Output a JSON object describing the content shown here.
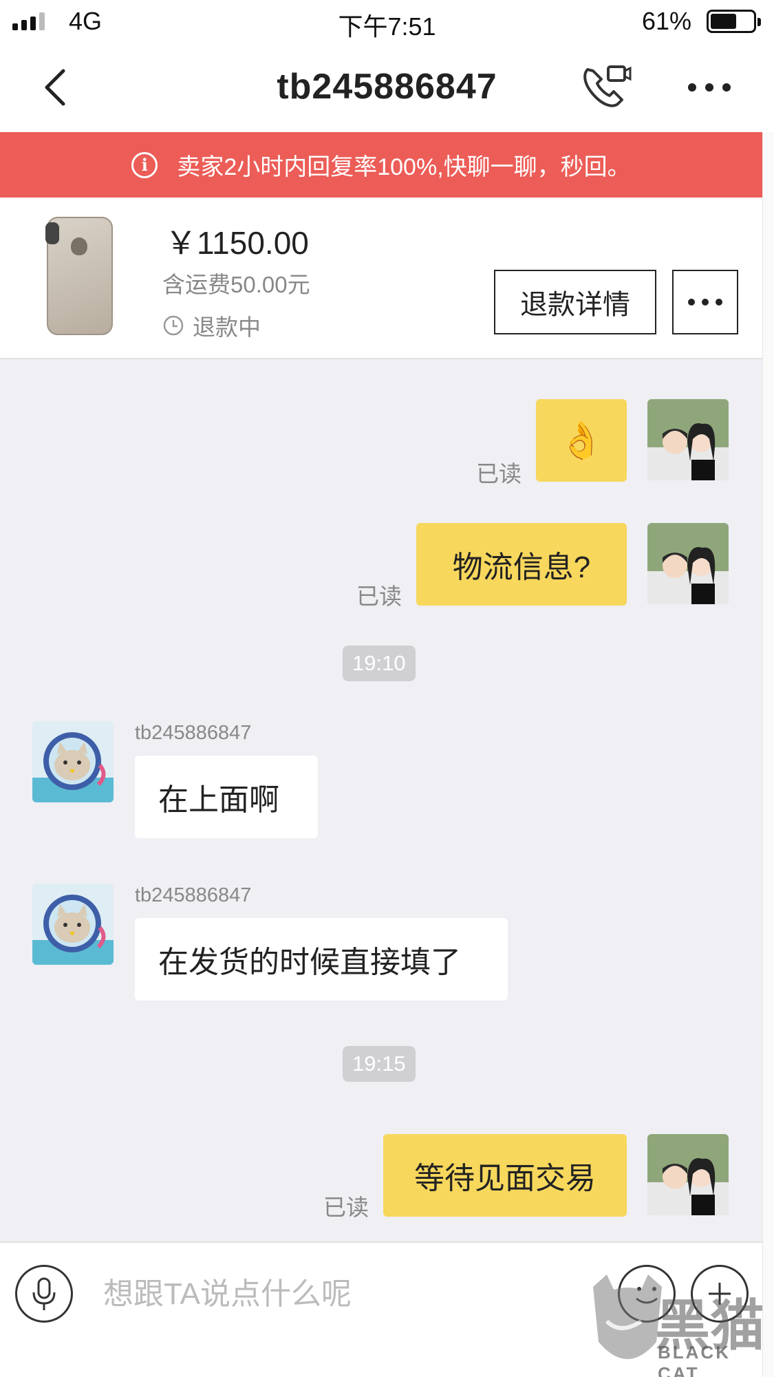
{
  "status_bar": {
    "carrier": "4G",
    "time": "下午7:51",
    "battery": "61%",
    "battery_level": 0.61
  },
  "nav": {
    "title": "tb245886847",
    "icons": [
      "back-icon",
      "phone-video-icon",
      "more-icon"
    ]
  },
  "banner": {
    "text": "卖家2小时内回复率100%,快聊一聊，秒回。",
    "icon": "info-icon",
    "color": "#ec5d57"
  },
  "order": {
    "price": "￥1150.00",
    "shipping": "含运费50.00元",
    "status": "退款中",
    "refund_button": "退款详情",
    "more_button": "more-icon"
  },
  "messages": {
    "m1": {
      "read": "已读",
      "content": "👌"
    },
    "m2": {
      "read": "已读",
      "content": "物流信息?"
    },
    "t1": "19:10",
    "m3": {
      "sender": "tb245886847",
      "content": "在上面啊"
    },
    "m4": {
      "sender": "tb245886847",
      "content": "在发货的时候直接填了"
    },
    "t2": "19:15",
    "m5": {
      "read": "已读",
      "content": "等待见面交易"
    }
  },
  "input": {
    "placeholder": "想跟TA说点什么呢"
  },
  "watermark": {
    "text": "黑猫",
    "sub": "BLACK CAT"
  },
  "colors": {
    "my_bubble": "#f7d75c",
    "their_bubble": "#ffffff",
    "chat_bg": "#efeff4"
  }
}
